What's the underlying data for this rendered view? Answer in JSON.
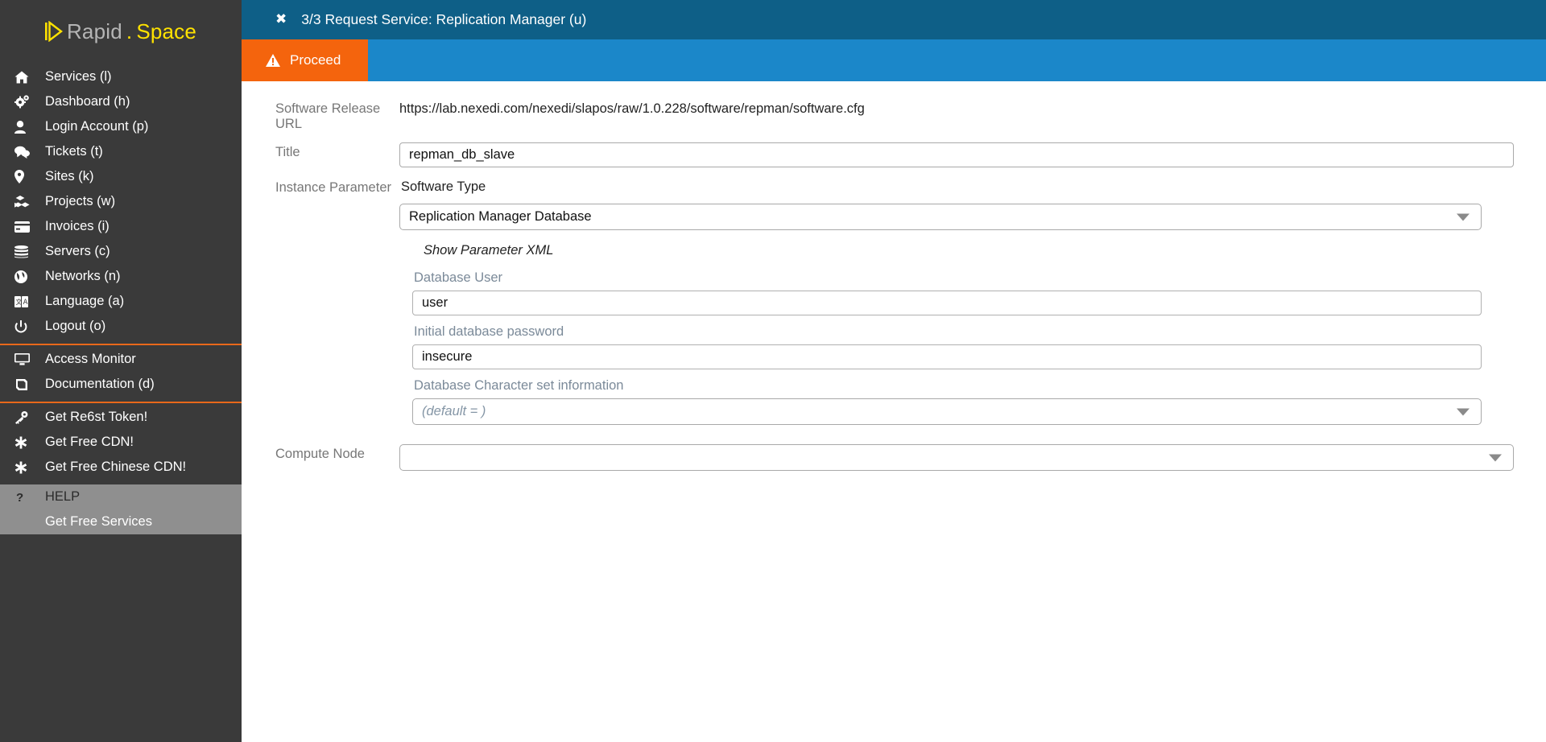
{
  "brand": {
    "logo_rapid": "Rapid",
    "logo_dot": ".",
    "logo_space": "Space"
  },
  "sidebar": {
    "main_items": [
      {
        "label": "Services (l)",
        "icon": "home-icon"
      },
      {
        "label": "Dashboard (h)",
        "icon": "gears-icon"
      },
      {
        "label": "Login Account (p)",
        "icon": "user-icon"
      },
      {
        "label": "Tickets (t)",
        "icon": "comments-icon"
      },
      {
        "label": "Sites (k)",
        "icon": "map-pin-icon"
      },
      {
        "label": "Projects (w)",
        "icon": "cubes-icon"
      },
      {
        "label": "Invoices (i)",
        "icon": "credit-card-icon"
      },
      {
        "label": "Servers (c)",
        "icon": "database-icon"
      },
      {
        "label": "Networks (n)",
        "icon": "globe-icon"
      },
      {
        "label": "Language (a)",
        "icon": "language-icon"
      },
      {
        "label": "Logout (o)",
        "icon": "power-icon"
      }
    ],
    "tools_items": [
      {
        "label": "Access Monitor",
        "icon": "monitor-icon"
      },
      {
        "label": "Documentation (d)",
        "icon": "book-icon"
      }
    ],
    "promo_items": [
      {
        "label": "Get Re6st Token!",
        "icon": "key-icon"
      },
      {
        "label": "Get Free CDN!",
        "icon": "asterisk-icon"
      },
      {
        "label": "Get Free Chinese CDN!",
        "icon": "asterisk-icon"
      }
    ],
    "help_items": [
      {
        "label": "HELP",
        "icon": "question-icon",
        "has_icon": true
      },
      {
        "label": "Get Free Services",
        "icon": "",
        "has_icon": false
      }
    ]
  },
  "titlebar": {
    "close_label": "✖",
    "title": "3/3 Request Service: Replication Manager (u)"
  },
  "actionbar": {
    "proceed_label": "Proceed"
  },
  "form": {
    "software_release_url_label": "Software Release URL",
    "software_release_url_value": "https://lab.nexedi.com/nexedi/slapos/raw/1.0.228/software/repman/software.cfg",
    "title_label": "Title",
    "title_value": "repman_db_slave",
    "instance_parameter_label": "Instance Parameter",
    "software_type_label": "Software Type",
    "software_type_value": "Replication Manager Database",
    "show_parameter_xml_label": "Show Parameter XML",
    "parameters": [
      {
        "label": "Database User",
        "value": "user",
        "type": "text",
        "name": "database-user"
      },
      {
        "label": "Initial database password",
        "value": "insecure",
        "type": "text",
        "name": "initial-database-password"
      },
      {
        "label": "Database Character set information",
        "value": "(default = )",
        "type": "select",
        "name": "database-character-set-information"
      }
    ],
    "compute_node_label": "Compute Node",
    "compute_node_value": ""
  },
  "colors": {
    "sidebar_bg": "#3a3a3a",
    "accent_orange": "#e8681a",
    "proceed_orange": "#f4640d",
    "titlebar_blue": "#0e5f87",
    "actionbar_blue": "#1b87c9",
    "logo_yellow": "#ffe200",
    "help_bg": "#8f8f8f"
  }
}
